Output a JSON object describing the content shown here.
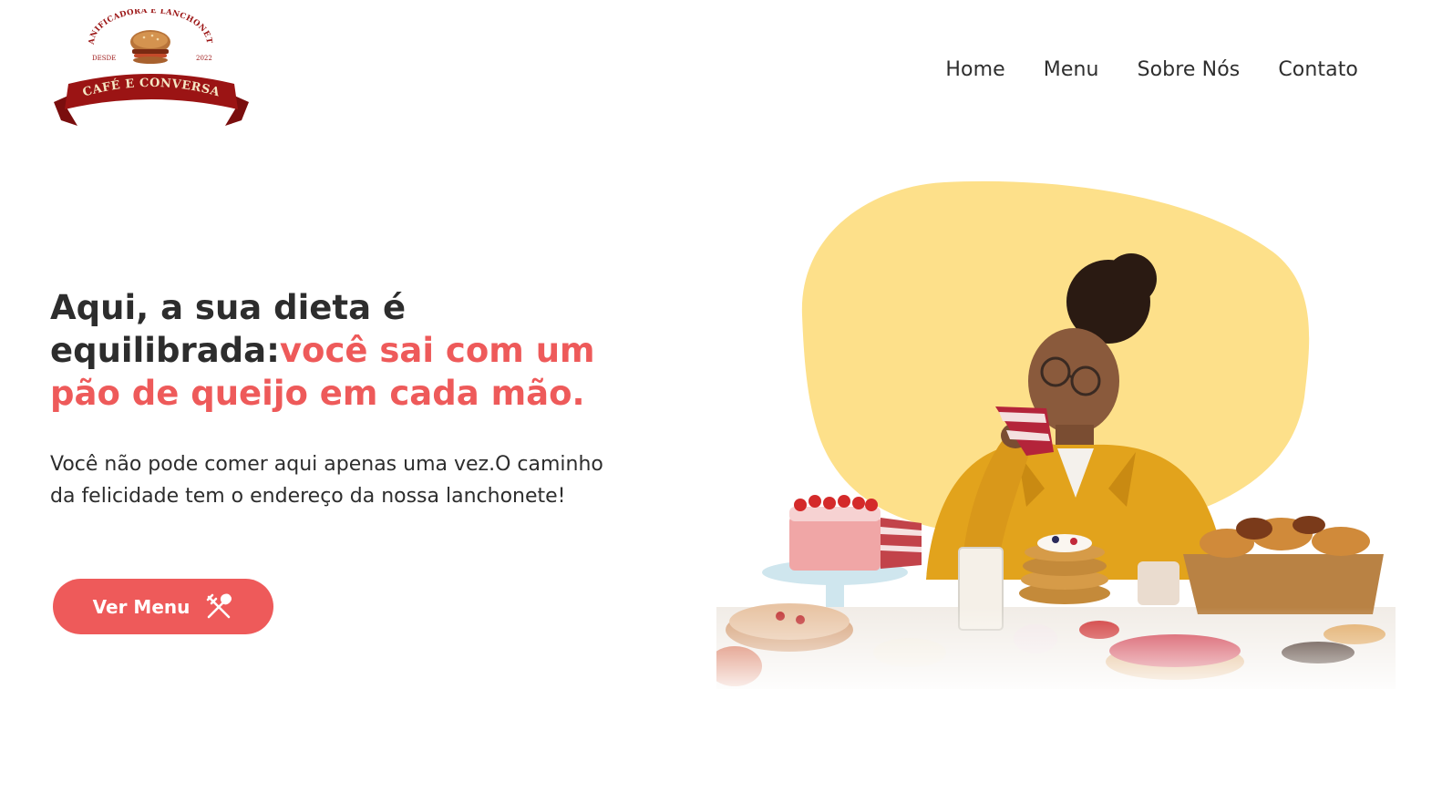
{
  "logo": {
    "arc_text": "PANIFICADORA E LANCHONETE",
    "since_label": "DESDE",
    "since_year": "2022",
    "banner_text": "CAFÉ E CONVERSA"
  },
  "nav": {
    "items": [
      {
        "label": "Home"
      },
      {
        "label": "Menu"
      },
      {
        "label": "Sobre Nós"
      },
      {
        "label": "Contato"
      }
    ]
  },
  "hero": {
    "title_part1": "Aqui, a sua dieta é equilibrada:",
    "title_part2": "você sai com um pão de queijo em cada mão.",
    "subtitle": "Você não pode comer aqui apenas uma vez.O caminho da felicidade tem o endereço da nossa lanchonete!",
    "cta_label": "Ver Menu",
    "cta_icon": "fork-knife-icon"
  },
  "colors": {
    "accent": "#ee5a5a",
    "text": "#2d2d2d",
    "blob": "#fde08a",
    "logo_red": "#9b1414"
  }
}
